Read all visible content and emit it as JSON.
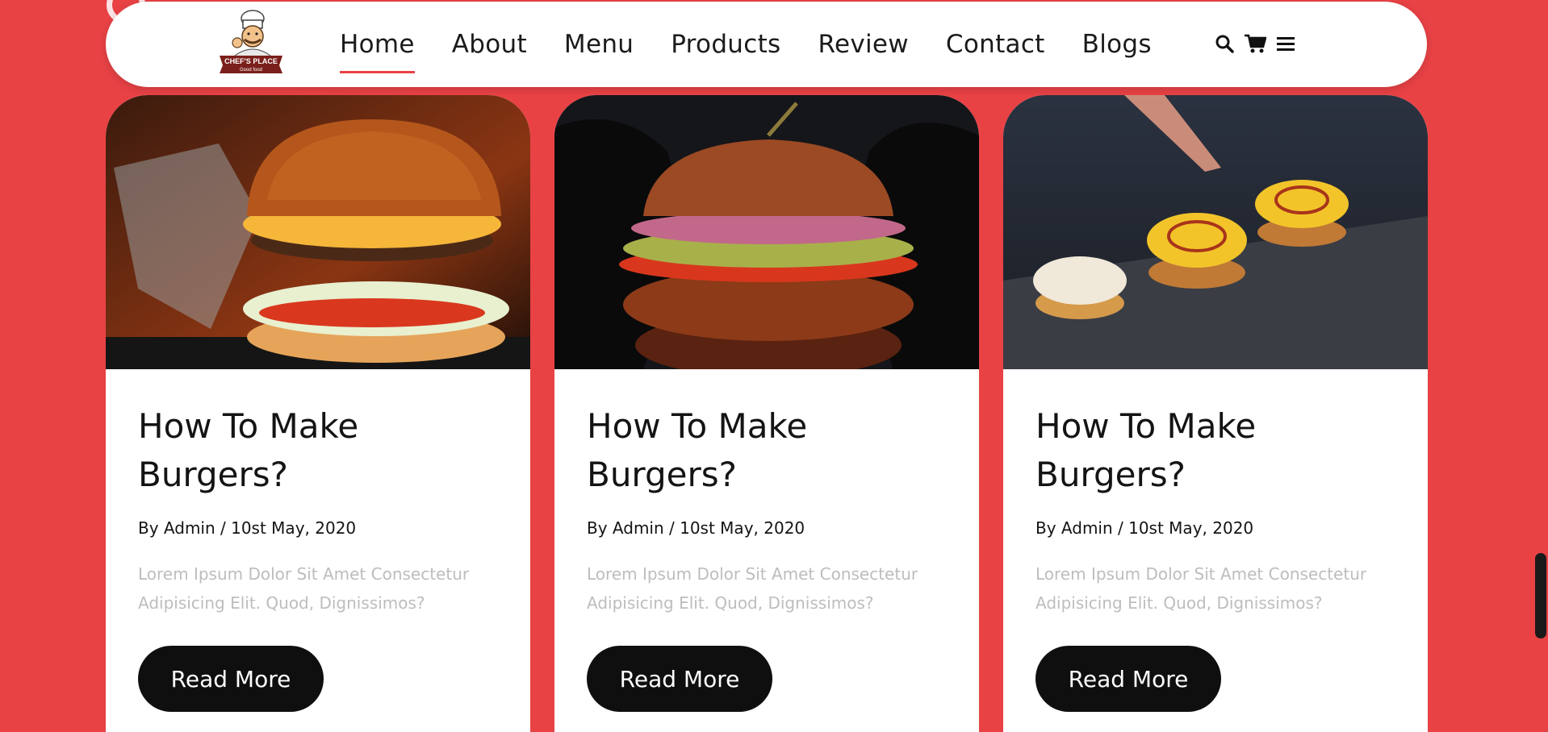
{
  "brand": {
    "logo_line1": "CHEF'S PLACE",
    "logo_line2": "Good food"
  },
  "nav": {
    "items": [
      {
        "label": "Home",
        "active": true
      },
      {
        "label": "About",
        "active": false
      },
      {
        "label": "Menu",
        "active": false
      },
      {
        "label": "Products",
        "active": false
      },
      {
        "label": "Review",
        "active": false
      },
      {
        "label": "Contact",
        "active": false
      },
      {
        "label": "Blogs",
        "active": false
      }
    ],
    "icons": [
      "search-icon",
      "cart-icon",
      "menu-bars-icon"
    ]
  },
  "colors": {
    "accent": "#e84245",
    "button": "#0f0f10"
  },
  "cards": [
    {
      "title": "How To Make Burgers?",
      "meta": "By Admin / 10st May, 2020",
      "desc": "Lorem Ipsum Dolor Sit Amet Consectetur Adipisicing Elit. Quod, Dignissimos?",
      "button": "Read More"
    },
    {
      "title": "How To Make Burgers?",
      "meta": "By Admin / 10st May, 2020",
      "desc": "Lorem Ipsum Dolor Sit Amet Consectetur Adipisicing Elit. Quod, Dignissimos?",
      "button": "Read More"
    },
    {
      "title": "How To Make Burgers?",
      "meta": "By Admin / 10st May, 2020",
      "desc": "Lorem Ipsum Dolor Sit Amet Consectetur Adipisicing Elit. Quod, Dignissimos?",
      "button": "Read More"
    }
  ]
}
